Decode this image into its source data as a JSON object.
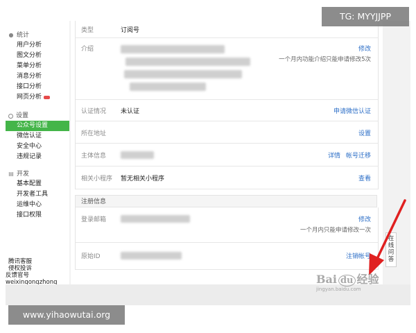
{
  "overlay": {
    "tg_badge": "TG: MYYJJPP",
    "url_badge": "www.yihaowutai.org"
  },
  "watermark": {
    "brand": "Bai",
    "suffix": "经验",
    "sub": "jingyan.baidu.com"
  },
  "sidebar": {
    "stats": {
      "title": "统计",
      "items": [
        "用户分析",
        "图文分析",
        "菜单分析",
        "消息分析",
        "接口分析",
        "网页分析"
      ]
    },
    "settings": {
      "title": "设置",
      "items": [
        "公众号设置",
        "微信认证",
        "安全中心",
        "违规记录"
      ],
      "active": "公众号设置"
    },
    "dev": {
      "title": "开发",
      "items": [
        "基本配置",
        "开发者工具",
        "运维中心",
        "接口权限"
      ]
    },
    "bottom_links": [
      "腾讯客服",
      "侵权投诉",
      "反馈官号",
      "weixingongzhong"
    ]
  },
  "info": {
    "type_row": {
      "label": "类型",
      "value": "订阅号"
    },
    "intro_row": {
      "label": "介绍",
      "action": "修改",
      "hint": "一个月内功能介绍只能申请修改5次"
    },
    "auth_row": {
      "label": "认证情况",
      "value": "未认证",
      "action": "申请微信认证"
    },
    "address_row": {
      "label": "所在地址",
      "action": "设置"
    },
    "subject_row": {
      "label": "主体信息",
      "action1": "详情",
      "action2": "帐号迁移"
    },
    "miniprog_row": {
      "label": "相关小程序",
      "value": "暂无相关小程序",
      "action": "查看"
    }
  },
  "register": {
    "title": "注册信息",
    "email_row": {
      "label": "登录邮箱",
      "action": "修改",
      "hint": "一个月内只能申请修改一次"
    },
    "id_row": {
      "label": "原始ID",
      "action": "注销帐号"
    }
  },
  "right_tab": "在线问答",
  "colors": {
    "accent_green": "#44b549",
    "link_blue": "#2d6fc7",
    "arrow_red": "#e02020"
  }
}
